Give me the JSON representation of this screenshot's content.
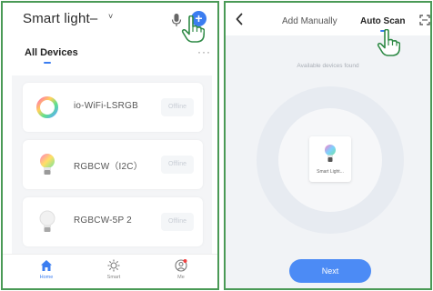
{
  "left": {
    "header": {
      "home_name": "Smart light–",
      "caret": "˅",
      "mic_icon": "mic-icon",
      "add_icon": "plus-icon",
      "add_symbol": "+"
    },
    "tabs": {
      "all_devices": "All Devices",
      "more": "···"
    },
    "devices": [
      {
        "name": "io-WiFi-LSRGB",
        "icon": "ring-light-icon",
        "action": "Offline"
      },
      {
        "name": "RGBCW（I2C）",
        "icon": "color-bulb-icon",
        "action": "Offline"
      },
      {
        "name": "RGBCW-5P 2",
        "icon": "white-bulb-icon",
        "action": "Offline"
      }
    ],
    "nav": [
      {
        "label": "Home",
        "icon": "home-icon",
        "active": true
      },
      {
        "label": "Smart",
        "icon": "sun-icon",
        "active": false
      },
      {
        "label": "Me",
        "icon": "profile-icon",
        "active": false
      }
    ]
  },
  "right": {
    "header": {
      "back_icon": "back-arrow-icon",
      "tab_manual": "Add Manually",
      "tab_auto": "Auto Scan",
      "scan_icon": "scan-frame-icon"
    },
    "status_text": "Available devices found",
    "found_device": {
      "name": "Smart Light...",
      "icon": "color-bulb-icon"
    },
    "next_label": "Next"
  },
  "colors": {
    "frame": "#4a9a56",
    "accent": "#3b7df0",
    "next_button": "#4c8bf5",
    "list_bg": "#f4f5f7",
    "scan_bg": "#f1f3f6"
  },
  "overlay": {
    "hand_icon": "pointing-hand-icon"
  }
}
